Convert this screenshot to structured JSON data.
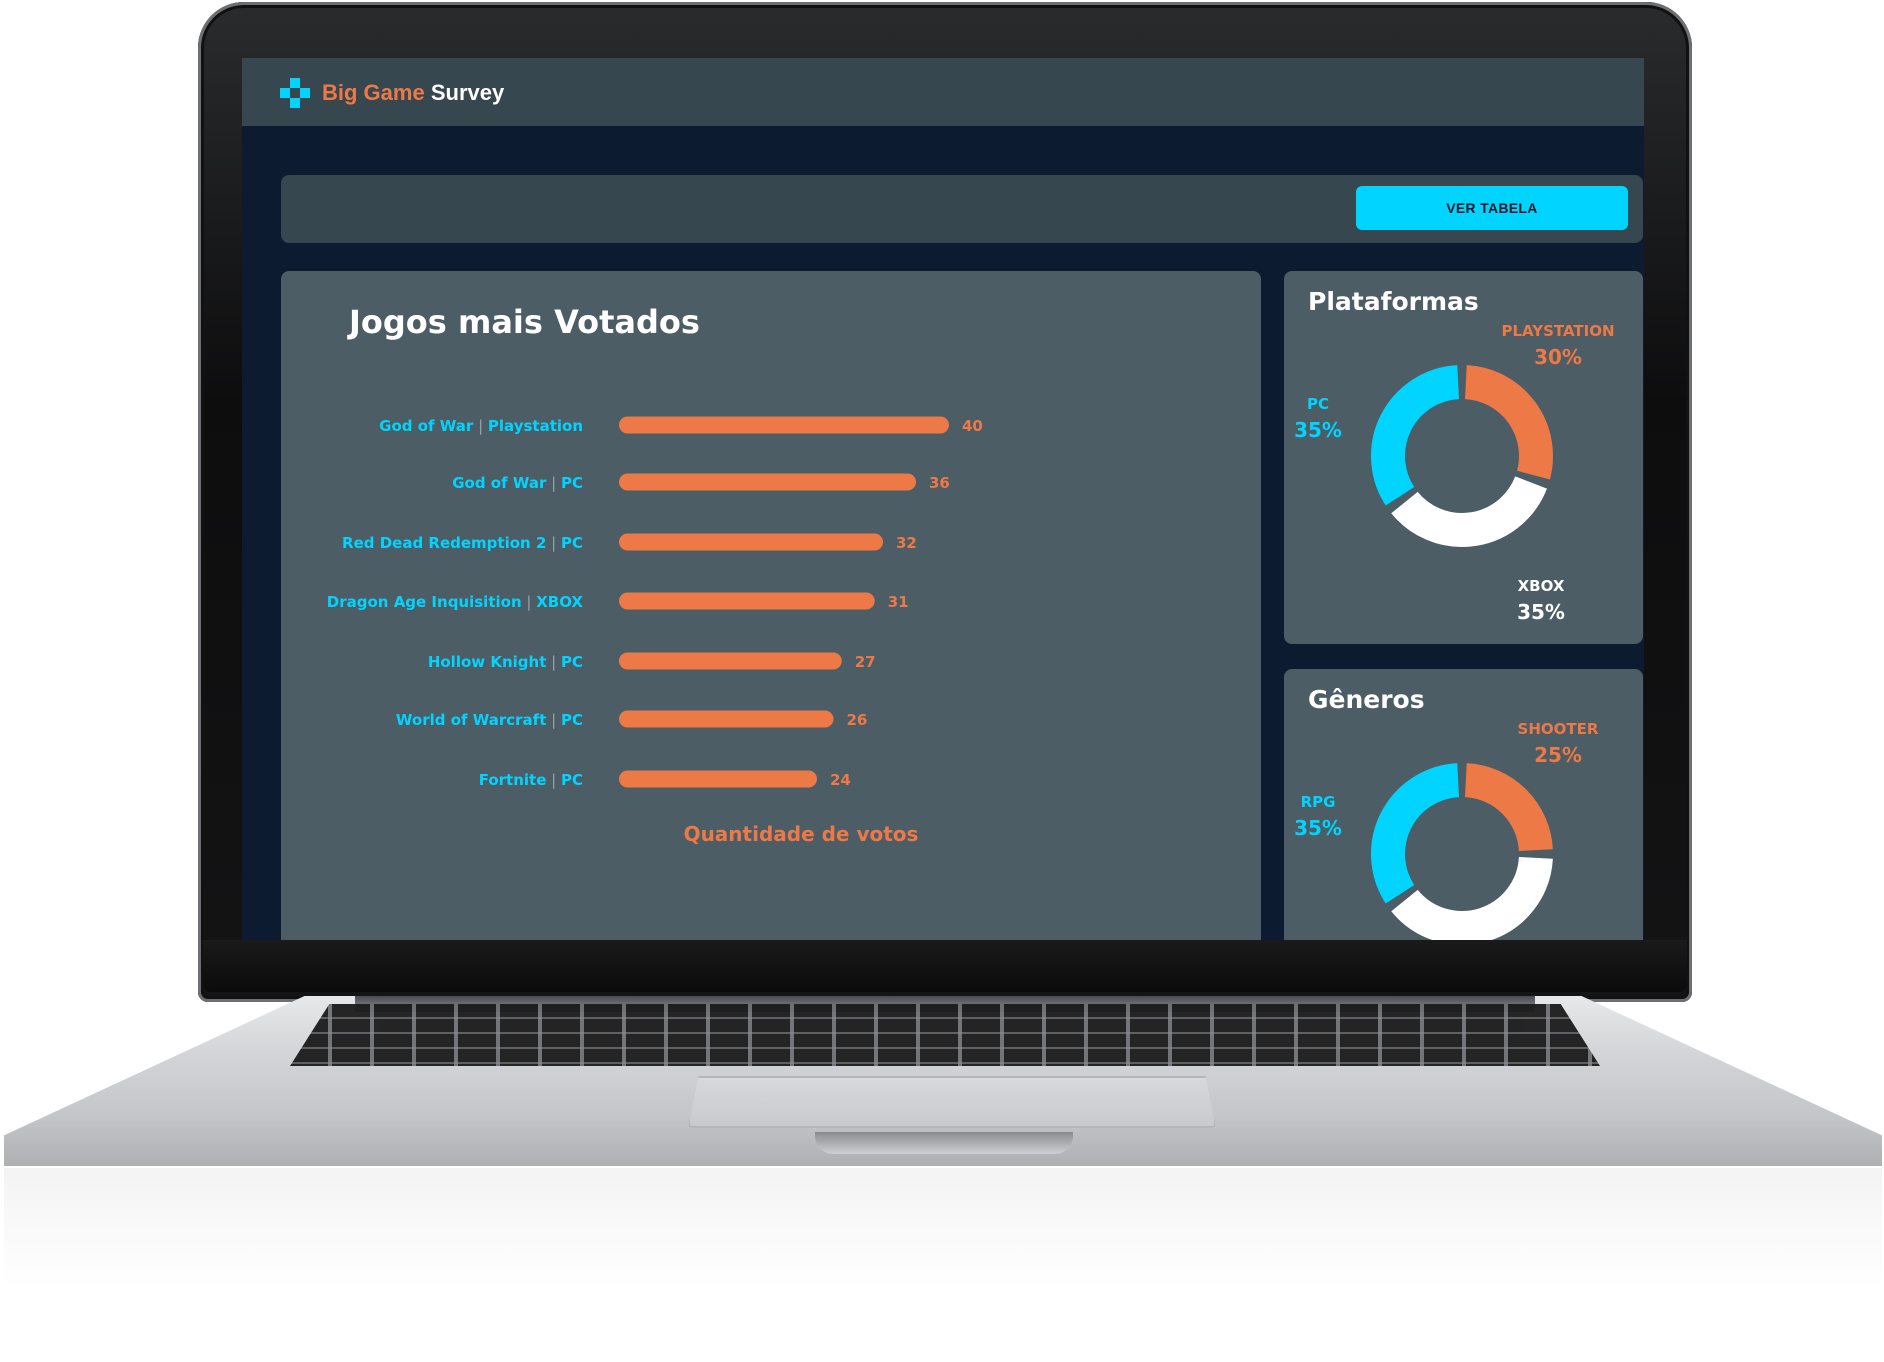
{
  "app": {
    "brand_part1": "Big Game",
    "brand_part2": "Survey",
    "icon": "gamepad-cross-icon"
  },
  "filter": {
    "button_label": "VER TABELA"
  },
  "colors": {
    "orange": "#ed7947",
    "cyan": "#00d4ff",
    "white": "#ffffff",
    "card": "#4d5d66",
    "nav": "#37474f",
    "screen_bg": "#0c1b2f"
  },
  "main_chart": {
    "title": "Jogos mais Votados",
    "xlabel": "Quantidade de votos"
  },
  "platforms": {
    "title": "Plataformas"
  },
  "genres": {
    "title": "Gêneros"
  },
  "chart_data": [
    {
      "type": "bar",
      "orientation": "horizontal",
      "title": "Jogos mais Votados",
      "xlabel": "Quantidade de votos",
      "categories": [
        {
          "game": "God of War",
          "platform": "Playstation"
        },
        {
          "game": "God of War",
          "platform": "PC"
        },
        {
          "game": "Red Dead Redemption 2",
          "platform": "PC"
        },
        {
          "game": "Dragon Age Inquisition",
          "platform": "XBOX"
        },
        {
          "game": "Hollow Knight",
          "platform": "PC"
        },
        {
          "game": "World of Warcraft",
          "platform": "PC"
        },
        {
          "game": "Fortnite",
          "platform": "PC"
        }
      ],
      "values": [
        40,
        36,
        32,
        31,
        27,
        26,
        24
      ],
      "value_labels": [
        "40",
        "36",
        "32",
        "31",
        "27",
        "26",
        "24"
      ],
      "color": "#ed7947"
    },
    {
      "type": "pie",
      "style": "donut",
      "title": "Plataformas",
      "slices": [
        {
          "label": "PLAYSTATION",
          "value": 30,
          "pct_label": "30%",
          "color": "#ed7947"
        },
        {
          "label": "XBOX",
          "value": 35,
          "pct_label": "35%",
          "color": "#ffffff"
        },
        {
          "label": "PC",
          "value": 35,
          "pct_label": "35%",
          "color": "#00d4ff"
        }
      ]
    },
    {
      "type": "pie",
      "style": "donut",
      "title": "Gêneros",
      "slices": [
        {
          "label": "SHOOTER",
          "value": 25,
          "pct_label": "25%",
          "color": "#ed7947"
        },
        {
          "label": "",
          "value": 40,
          "pct_label": "",
          "color": "#ffffff"
        },
        {
          "label": "RPG",
          "value": 35,
          "pct_label": "35%",
          "color": "#00d4ff"
        }
      ]
    }
  ]
}
